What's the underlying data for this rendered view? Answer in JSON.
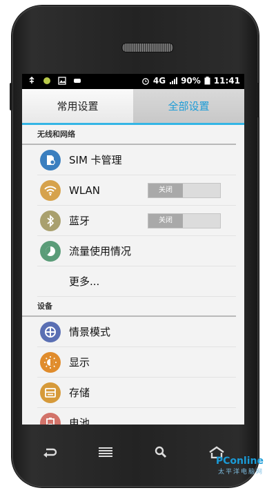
{
  "statusbar": {
    "network": "4G",
    "battery": "90%",
    "time": "11:41"
  },
  "tabs": [
    {
      "label": "常用设置",
      "active": false
    },
    {
      "label": "全部设置",
      "active": true
    }
  ],
  "sections": [
    {
      "header": "无线和网络",
      "items": [
        {
          "label": "SIM 卡管理",
          "icon": "sim-card-icon",
          "color": "#3b7fbf"
        },
        {
          "label": "WLAN",
          "icon": "wifi-icon",
          "color": "#d6a24c",
          "toggle": "关闭"
        },
        {
          "label": "蓝牙",
          "icon": "bluetooth-icon",
          "color": "#a9a06e",
          "toggle": "关闭"
        },
        {
          "label": "流量使用情况",
          "icon": "data-usage-icon",
          "color": "#5a9c78"
        },
        {
          "label": "更多..."
        }
      ]
    },
    {
      "header": "设备",
      "items": [
        {
          "label": "情景模式",
          "icon": "profile-icon",
          "color": "#5a6fb3"
        },
        {
          "label": "显示",
          "icon": "display-icon",
          "color": "#e08c2c"
        },
        {
          "label": "存储",
          "icon": "storage-icon",
          "color": "#d69a3a"
        },
        {
          "label": "电池",
          "icon": "battery-icon",
          "color": "#d2736a"
        }
      ]
    }
  ],
  "watermark": {
    "brand": "PConline",
    "sub": "太平洋电脑网"
  },
  "colors": {
    "accent": "#33b5e5",
    "active_tab_text": "#1a9bd7"
  }
}
